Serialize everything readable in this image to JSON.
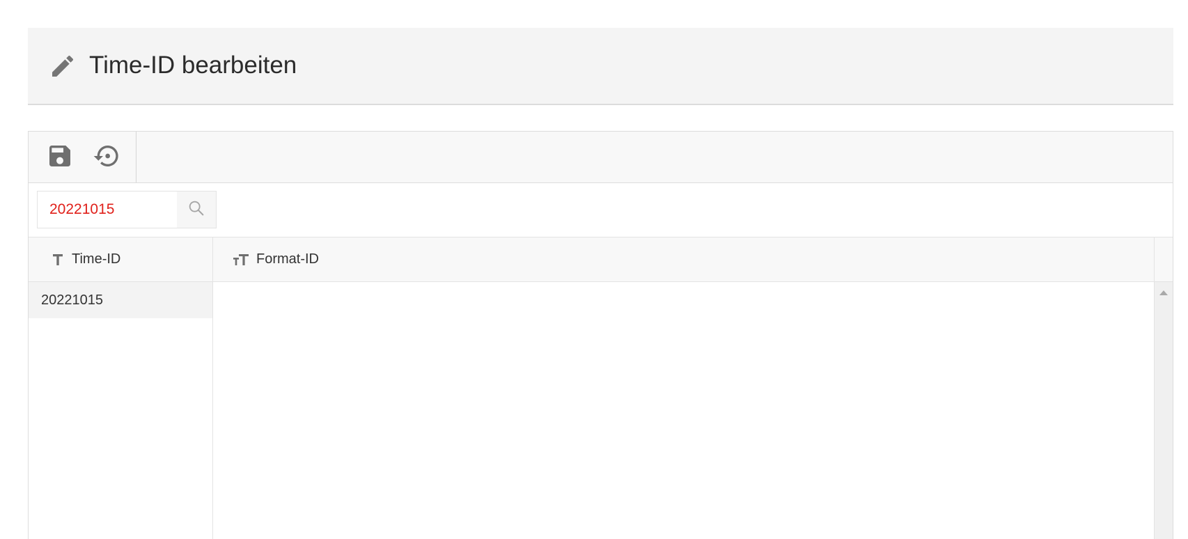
{
  "header": {
    "title": "Time-ID bearbeiten",
    "icon": "pencil-icon"
  },
  "toolbar": {
    "save_icon": "floppy-disk-icon",
    "reset_icon": "restore-icon"
  },
  "search": {
    "value": "20221015",
    "icon": "search-icon",
    "value_color": "#e0201a"
  },
  "columns": [
    {
      "label": "Time-ID",
      "icon": "text-type-icon"
    },
    {
      "label": "Format-ID",
      "icon": "text-size-icon"
    }
  ],
  "rows": [
    {
      "time_id": "20221015",
      "format_id": ""
    }
  ]
}
